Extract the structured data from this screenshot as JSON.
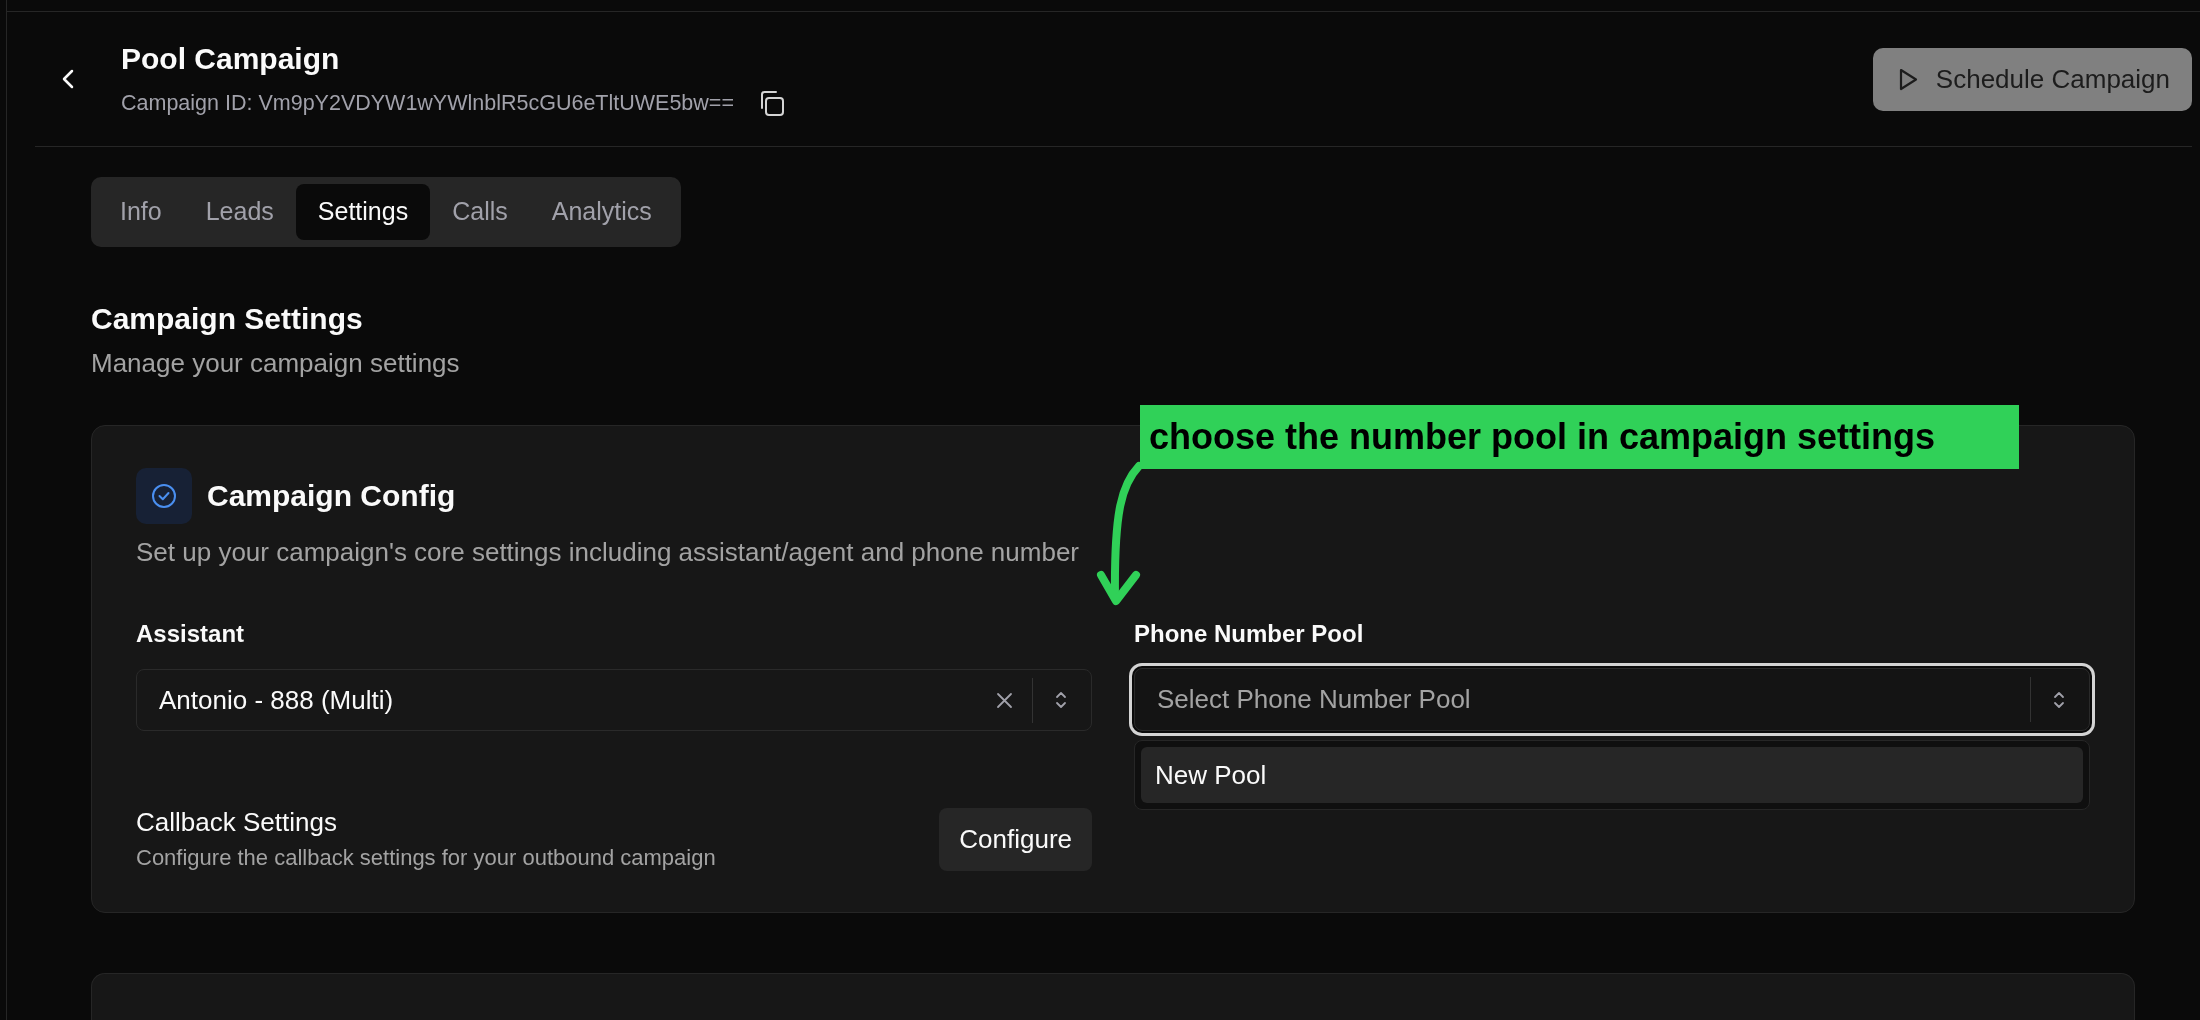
{
  "header": {
    "title": "Pool Campaign",
    "campaign_id": "Campaign ID: Vm9pY2VDYW1wYWlnblR5cGU6eTltUWE5bw==",
    "schedule_button": {
      "label": "Schedule Campaign",
      "disabled": true
    }
  },
  "tabs": [
    {
      "label": "Info",
      "selected": false
    },
    {
      "label": "Leads",
      "selected": false
    },
    {
      "label": "Settings",
      "selected": true
    },
    {
      "label": "Calls",
      "selected": false
    },
    {
      "label": "Analytics",
      "selected": false
    }
  ],
  "page": {
    "title": "Campaign Settings",
    "subtitle": "Manage your campaign settings"
  },
  "campaign_config": {
    "title": "Campaign Config",
    "description": "Set up your campaign's core settings including assistant/agent and phone number",
    "assistant": {
      "label": "Assistant",
      "value": "Antonio - 888 (Multi)"
    },
    "phone_number_pool": {
      "label": "Phone Number Pool",
      "placeholder": "Select Phone Number Pool",
      "focused": true,
      "expanded": true,
      "options": [
        {
          "label": "New Pool",
          "highlighted": true
        }
      ]
    },
    "callback": {
      "title": "Callback Settings",
      "description": "Configure the callback settings for your outbound campaign",
      "button": "Configure"
    }
  },
  "annotation": {
    "text": "choose the number pool in campaign settings"
  }
}
